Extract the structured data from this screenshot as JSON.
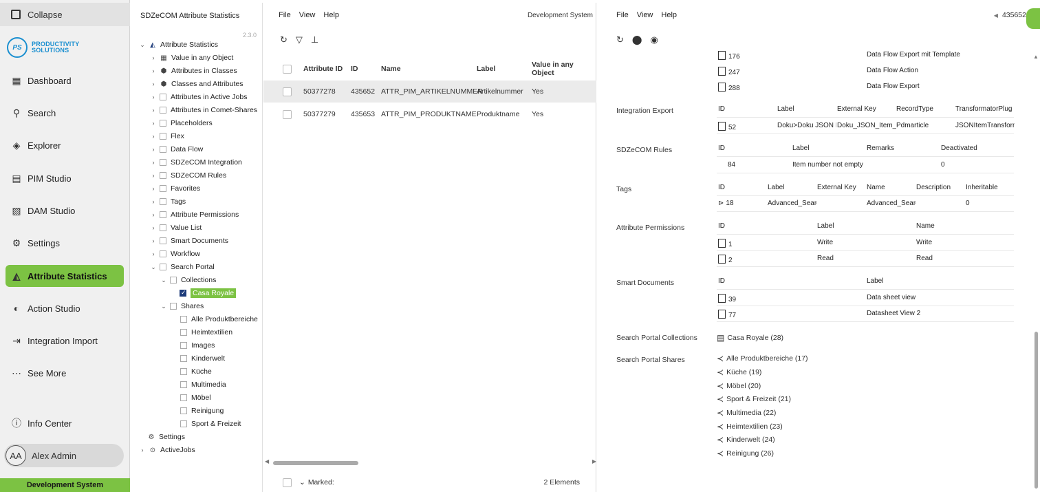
{
  "nav": {
    "collapse": "Collapse",
    "logo_mark": "PS",
    "logo_line1": "PRODUCTIVITY",
    "logo_line2": "SOLUTIONS",
    "items": [
      {
        "label": "Dashboard",
        "icon": "dashboard-icon"
      },
      {
        "label": "Search",
        "icon": "search-icon"
      },
      {
        "label": "Explorer",
        "icon": "explorer-icon"
      },
      {
        "label": "PIM Studio",
        "icon": "pim-icon"
      },
      {
        "label": "DAM Studio",
        "icon": "image-icon"
      },
      {
        "label": "Settings",
        "icon": "gear-icon"
      },
      {
        "label": "Attribute Statistics",
        "icon": "chart-icon",
        "active": true
      },
      {
        "label": "Action Studio",
        "icon": "action-icon"
      },
      {
        "label": "Integration Import",
        "icon": "import-icon"
      },
      {
        "label": "See More",
        "icon": "more-icon"
      }
    ],
    "info_center": "Info Center",
    "user_initials": "AA",
    "user_name": "Alex Admin",
    "system": "Development System"
  },
  "tree": {
    "title": "SDZeCOM Attribute Statistics",
    "version": "2.3.0",
    "root": "Attribute Statistics",
    "items": [
      "Value in any Object",
      "Attributes in Classes",
      "Classes and Attributes",
      "Attributes in Active Jobs",
      "Attributes in Comet-Shares",
      "Placeholders",
      "Flex",
      "Data Flow",
      "SDZeCOM Integration",
      "SDZeCOM Rules",
      "Favorites",
      "Tags",
      "Attribute Permissions",
      "Value List",
      "Smart Documents",
      "Workflow",
      "Search Portal"
    ],
    "collections": "Collections",
    "casa": "Casa Royale",
    "shares": "Shares",
    "share_items": [
      "Alle Produktbereiche",
      "Heimtextilien",
      "Images",
      "Kinderwelt",
      "Küche",
      "Multimedia",
      "Möbel",
      "Reinigung",
      "Sport & Freizeit"
    ],
    "settings": "Settings",
    "activejobs": "ActiveJobs"
  },
  "menu": {
    "file": "File",
    "view": "View",
    "help": "Help"
  },
  "mid": {
    "system": "Development System",
    "columns": [
      "Attribute ID",
      "ID",
      "Name",
      "Label",
      "Value in any Object"
    ],
    "rows": [
      {
        "aid": "50377278",
        "id": "435652",
        "name": "ATTR_PIM_ARTIKELNUMMER",
        "label": "Artikelnummer",
        "val": "Yes"
      },
      {
        "aid": "50377279",
        "id": "435653",
        "name": "ATTR_PIM_PRODUKTNAME",
        "label": "Produktname",
        "val": "Yes"
      }
    ],
    "marked": "Marked:",
    "count": "2 Elements"
  },
  "right": {
    "id": "435652",
    "dataflow": [
      {
        "id": "176",
        "label": "Data Flow Export mit Template"
      },
      {
        "id": "247",
        "label": "Data Flow Action"
      },
      {
        "id": "288",
        "label": "Data Flow Export"
      }
    ],
    "integration_export": {
      "label": "Integration Export",
      "cols": [
        "ID",
        "Label",
        "External Key",
        "RecordType",
        "TransformatorPlug"
      ],
      "row": [
        "52",
        "Doku>Doku JSON It",
        "Doku_JSON_Item_E:",
        "Pdmarticle",
        "JSONItemTransform"
      ]
    },
    "rules": {
      "label": "SDZeCOM Rules",
      "cols": [
        "ID",
        "Label",
        "Remarks",
        "Deactivated"
      ],
      "row": [
        "84",
        "Item number not empty",
        "",
        "0"
      ]
    },
    "tags": {
      "label": "Tags",
      "cols": [
        "ID",
        "Label",
        "External Key",
        "Name",
        "Description",
        "Inheritable"
      ],
      "row": [
        "18",
        "Advanced_Searc",
        "",
        "Advanced_Searc",
        "",
        "0"
      ]
    },
    "permissions": {
      "label": "Attribute Permissions",
      "cols": [
        "ID",
        "Label",
        "Name"
      ],
      "rows": [
        [
          "1",
          "Write",
          "Write"
        ],
        [
          "2",
          "Read",
          "Read"
        ]
      ]
    },
    "smartdocs": {
      "label": "Smart Documents",
      "cols": [
        "ID",
        "Label"
      ],
      "rows": [
        [
          "39",
          "Data sheet view"
        ],
        [
          "77",
          "Datasheet View 2"
        ]
      ]
    },
    "collections": {
      "label": "Search Portal Collections",
      "value": "Casa Royale (28)"
    },
    "shares": {
      "label": "Search Portal Shares",
      "items": [
        "Alle Produktbereiche (17)",
        "Küche (19)",
        "Möbel (20)",
        "Sport & Freizeit (21)",
        "Multimedia (22)",
        "Heimtextilien (23)",
        "Kinderwelt (24)",
        "Reinigung (26)"
      ]
    }
  }
}
